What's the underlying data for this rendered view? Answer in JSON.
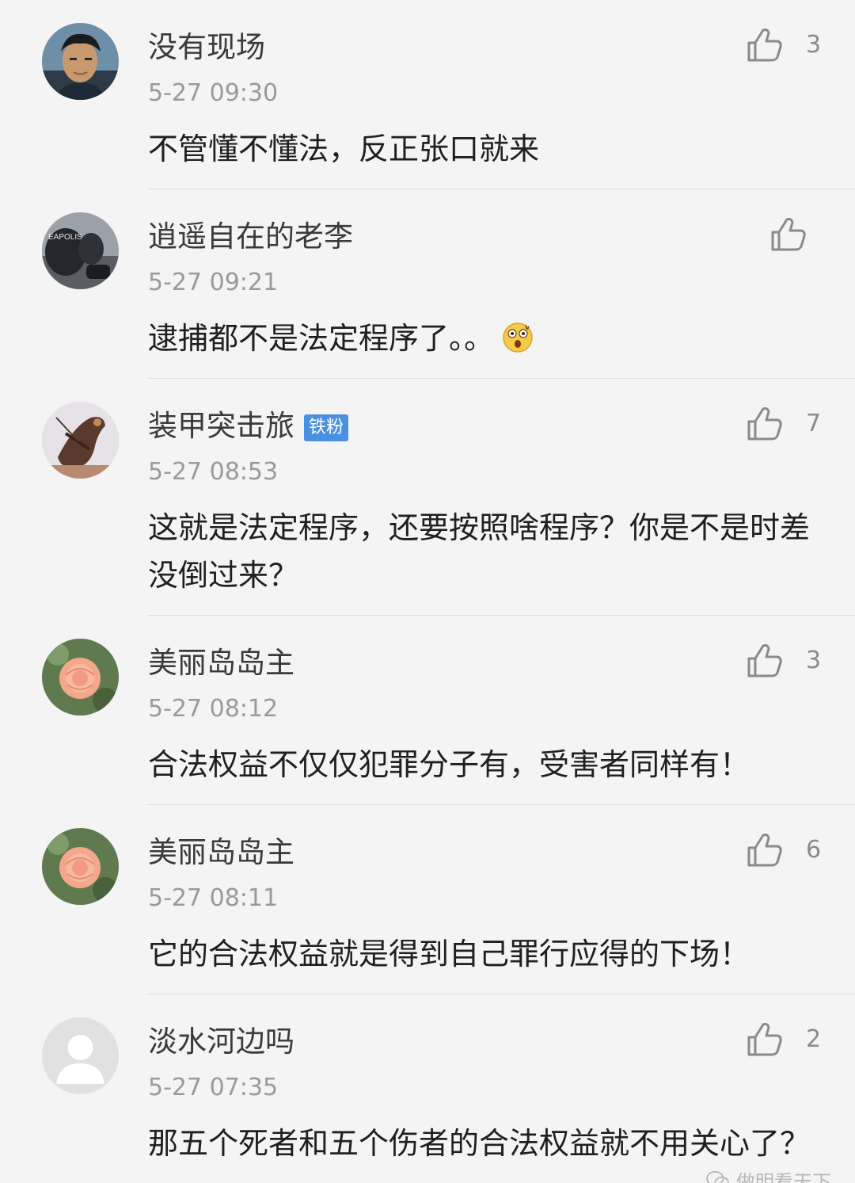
{
  "comments": [
    {
      "username": "没有现场",
      "timestamp": "5-27 09:30",
      "text": "不管懂不懂法，反正张口就来",
      "likes": "3"
    },
    {
      "username": "逍遥自在的老李",
      "timestamp": "5-27 09:21",
      "text": "逮捕都不是法定程序了。。",
      "likes": ""
    },
    {
      "username": "装甲突击旅",
      "badge": "铁粉",
      "timestamp": "5-27 08:53",
      "text": "这就是法定程序，还要按照啥程序？你是不是时差没倒过来？",
      "likes": "7"
    },
    {
      "username": "美丽岛岛主",
      "timestamp": "5-27 08:12",
      "text": "合法权益不仅仅犯罪分子有，受害者同样有！",
      "likes": "3"
    },
    {
      "username": "美丽岛岛主",
      "timestamp": "5-27 08:11",
      "text": "它的合法权益就是得到自己罪行应得的下场！",
      "likes": "6"
    },
    {
      "username": "淡水河边吗",
      "timestamp": "5-27 07:35",
      "text": "那五个死者和五个伤者的合法权益就不用关心了？",
      "likes": "2"
    }
  ],
  "watermark": "做明看天下",
  "colors": {
    "background": "#f4f4f4",
    "badge": "#4a90e2",
    "timestamp": "#9a9a9a"
  }
}
